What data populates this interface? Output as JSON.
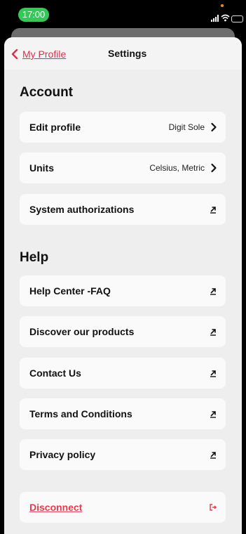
{
  "status_bar": {
    "time": "17:00"
  },
  "nav": {
    "back_label": "My Profile",
    "title": "Settings"
  },
  "account": {
    "title": "Account",
    "items": [
      {
        "label": "Edit profile",
        "value": "Digit Sole"
      },
      {
        "label": "Units",
        "value": "Celsius, Metric"
      },
      {
        "label": "System authorizations"
      }
    ]
  },
  "help": {
    "title": "Help",
    "items": [
      {
        "label": "Help Center -FAQ"
      },
      {
        "label": "Discover our products"
      },
      {
        "label": "Contact Us"
      },
      {
        "label": "Terms and Conditions"
      },
      {
        "label": "Privacy policy"
      }
    ]
  },
  "disconnect": {
    "label": "Disconnect"
  },
  "colors": {
    "accent": "#d9304c",
    "status_green": "#36c759",
    "background": "#eeeeee",
    "card": "#fafafa"
  },
  "icons": [
    "chevron-left-icon",
    "chevron-right-icon",
    "external-link-icon",
    "logout-icon",
    "signal-icon",
    "wifi-icon",
    "battery-icon"
  ]
}
